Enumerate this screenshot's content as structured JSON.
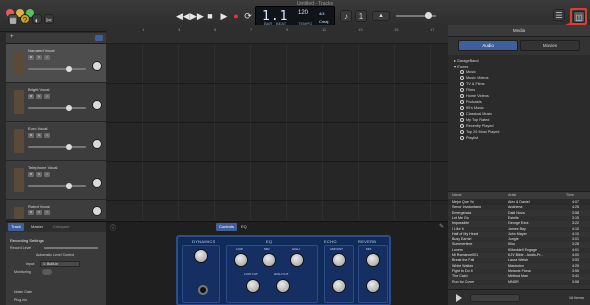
{
  "window": {
    "title": "Untitled - Tracks"
  },
  "lcd": {
    "display": "1.1",
    "sub1": "BAR",
    "sub2": "BEAT",
    "tempo": "120",
    "tempo_lbl": "TEMPO",
    "sig": "4/4",
    "key": "Cmaj"
  },
  "ruler": {
    "ticks": [
      "1",
      "3",
      "5",
      "7",
      "9",
      "11",
      "13",
      "15",
      "17"
    ]
  },
  "tracks": [
    {
      "name": "Narrated Vocal"
    },
    {
      "name": "Bright Vocal"
    },
    {
      "name": "Euro Vocal"
    },
    {
      "name": "Telephone Vocal"
    },
    {
      "name": "Robot Vocal"
    }
  ],
  "lower": {
    "tabs": [
      "Track",
      "Master",
      "Compare"
    ],
    "controls_tabs": [
      "Controls",
      "EQ"
    ],
    "recording_settings": "Recording Settings",
    "record_level": "Record Level",
    "auto_level": "Automatic Level Control",
    "input_label": "Input:",
    "input_val": "1: Built-in",
    "monitoring": "Monitoring",
    "noise_gate": "Noise Gate",
    "plugins": "Plug-ins",
    "amp_sections": [
      "DYNAMICS",
      "EQ",
      "ECHO",
      "REVERB"
    ],
    "knobs": [
      "LOW",
      "MID",
      "HIGH",
      "LOW CUT",
      "HIGH CUT",
      "AMOUNT",
      "MIX"
    ]
  },
  "media": {
    "header": "Media",
    "seg": [
      "Audio",
      "Movies"
    ],
    "tree": [
      "GarageBand",
      "iTunes",
      "Music",
      "Music Videos",
      "TV & Films",
      "Films",
      "Home Videos",
      "Podcasts",
      "90's Music",
      "Classical Music",
      "My Top Rated",
      "Recently Played",
      "Top 25 Most Played",
      "Playlist"
    ],
    "cols": [
      "Name",
      "Artist",
      "Time"
    ],
    "rows": [
      [
        "Mejor Que Yo",
        "Alex & Daniel",
        "4:07"
      ],
      [
        "Senor Involuntario",
        "Andriena",
        "4:25"
      ],
      [
        "Emergencia",
        "Daki Nova",
        "3:58"
      ],
      [
        "Let Me Go",
        "Estelle",
        "3:15"
      ],
      [
        "Impossible",
        "George Ezra",
        "3:22"
      ],
      [
        "I Like It",
        "James Bay",
        "4:10"
      ],
      [
        "Half of My Heart",
        "John Mayer",
        "4:10"
      ],
      [
        "Busy Earnin'",
        "Jungle",
        "3:01"
      ],
      [
        "Summertime",
        "Kiko",
        "3:28"
      ],
      [
        "Lovers",
        "Kilbeddell Engage",
        "4:01"
      ],
      [
        "Mi Romance001",
        "KJV Bible - Audio-Pr...",
        "4:00"
      ],
      [
        "Break the Fall",
        "Laura Welsh",
        "3:53"
      ],
      [
        "White Walker",
        "Mastodon",
        "4:25"
      ],
      [
        "Fight to Do It",
        "Melanie Fiona",
        "3:55"
      ],
      [
        "The Cash",
        "Method Man",
        "3:41"
      ],
      [
        "Run for Cover",
        "MNDR",
        "3:58"
      ]
    ],
    "footer": "16 items"
  }
}
